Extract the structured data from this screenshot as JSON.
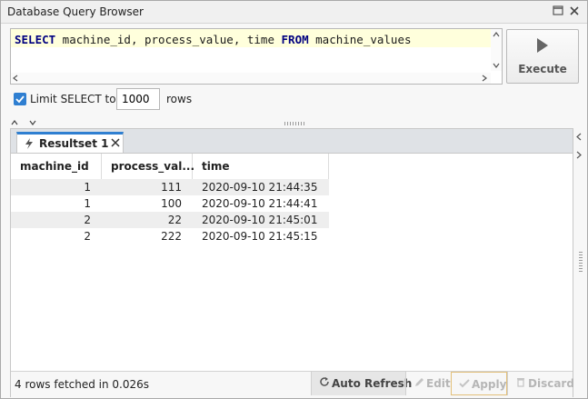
{
  "window": {
    "title": "Database Query Browser"
  },
  "editor": {
    "sql_select": "SELECT",
    "sql_columns": " machine_id, process_value, time ",
    "sql_from": "FROM",
    "sql_table": " machine_values"
  },
  "execute": {
    "label": "Execute"
  },
  "limit": {
    "label": "Limit SELECT to:",
    "value": "1000",
    "suffix": "rows",
    "checked": true
  },
  "results": {
    "tab_label": "Resultset 1",
    "columns": [
      "machine_id",
      "process_val...",
      "time"
    ],
    "rows": [
      {
        "machine_id": "1",
        "process_value": "111",
        "time": "2020-09-10 21:44:35"
      },
      {
        "machine_id": "1",
        "process_value": "100",
        "time": "2020-09-10 21:44:41"
      },
      {
        "machine_id": "2",
        "process_value": "22",
        "time": "2020-09-10 21:45:01"
      },
      {
        "machine_id": "2",
        "process_value": "222",
        "time": "2020-09-10 21:45:15"
      }
    ]
  },
  "status": {
    "text": "4 rows fetched in 0.026s",
    "auto_refresh": "Auto Refresh",
    "edit": "Edit",
    "apply": "Apply",
    "discard": "Discard"
  },
  "colors": {
    "accent": "#2f7fd1",
    "keyword": "#000080",
    "row_alt": "#eeeeee"
  }
}
